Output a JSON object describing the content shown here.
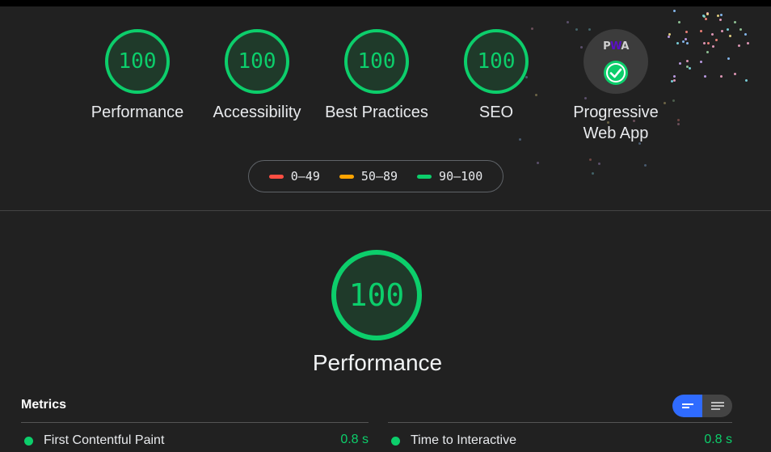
{
  "gauges": [
    {
      "score": "100",
      "label": "Performance"
    },
    {
      "score": "100",
      "label": "Accessibility"
    },
    {
      "score": "100",
      "label": "Best Practices"
    },
    {
      "score": "100",
      "label": "SEO"
    }
  ],
  "pwa": {
    "logo": "PWA",
    "label": "Progressive Web App"
  },
  "legend": [
    {
      "range": "0–49",
      "color": "#ff4e42"
    },
    {
      "range": "50–89",
      "color": "#ffa400"
    },
    {
      "range": "90–100",
      "color": "#0cce6b"
    }
  ],
  "main": {
    "score": "100",
    "label": "Performance"
  },
  "metrics": {
    "title": "Metrics",
    "items": [
      {
        "name": "First Contentful Paint",
        "value": "0.8 s"
      },
      {
        "name": "Time to Interactive",
        "value": "0.8 s"
      }
    ]
  },
  "colors": {
    "pass": "#0cce6b",
    "accent": "#2f6bff"
  }
}
